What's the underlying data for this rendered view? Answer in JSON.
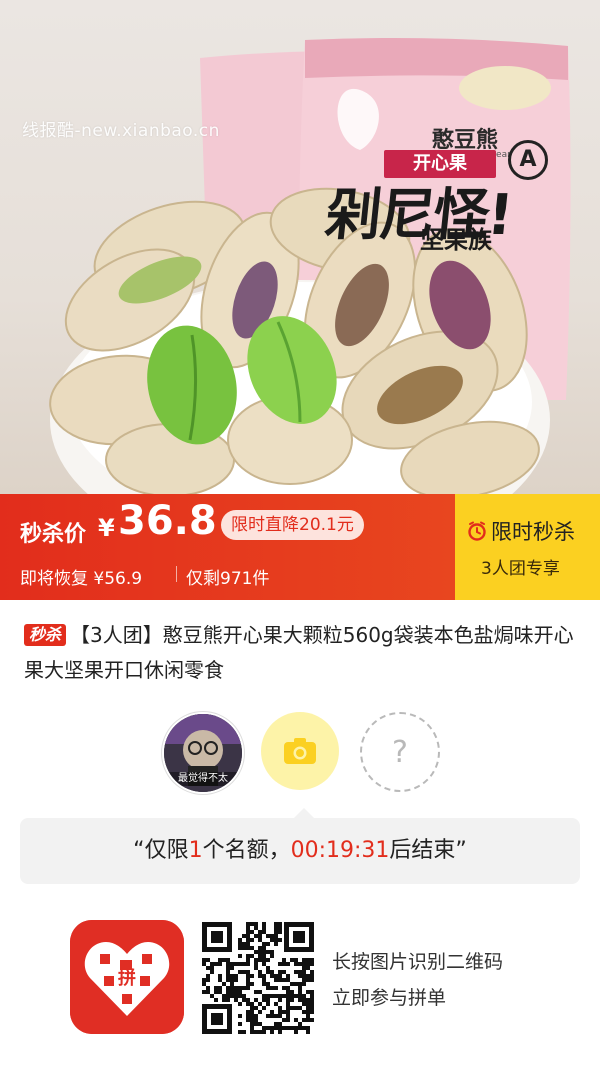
{
  "hero": {
    "watermark": "线报酷-new.xianbao.cn",
    "package": {
      "brand": "憨豆熊",
      "brand_sub": "Silly funny Bear",
      "product_tag": "开心果",
      "mark": "A",
      "slogan": "剁尼怪!",
      "slogan_sub": "坚果族"
    }
  },
  "price": {
    "label": "秒杀价",
    "currency": "¥",
    "value": "36.8",
    "drop_badge": "限时直降20.1元",
    "restore": "即将恢复 ¥56.9",
    "stock": "仅剩971件",
    "flash_label": "限时秒杀",
    "group_exclusive": "3人团专享"
  },
  "product": {
    "badge": "秒杀",
    "title": "【3人团】憨豆熊开心果大颗粒560g袋装本色盐焗味开心果大坚果开口休闲零食"
  },
  "group": {
    "member_caption": "最觉得不太",
    "empty_slot": "?"
  },
  "countdown": {
    "open_quote": "“",
    "prefix": "仅限",
    "slots": "1",
    "middle": "个名额，",
    "timer": "00:19:31",
    "suffix": "后结束",
    "close_quote": "”"
  },
  "footer": {
    "line1": "长按图片识别二维码",
    "line2": "立即参与拼单",
    "app_logo_text": "拼"
  },
  "colors": {
    "accent_red": "#e22d1c",
    "flash_yellow": "#fbd021",
    "camera_yellow": "#fdf3a8"
  },
  "icons": [
    "clock-icon",
    "camera-icon",
    "question-icon",
    "pinduoduo-logo-icon",
    "qr-code"
  ]
}
